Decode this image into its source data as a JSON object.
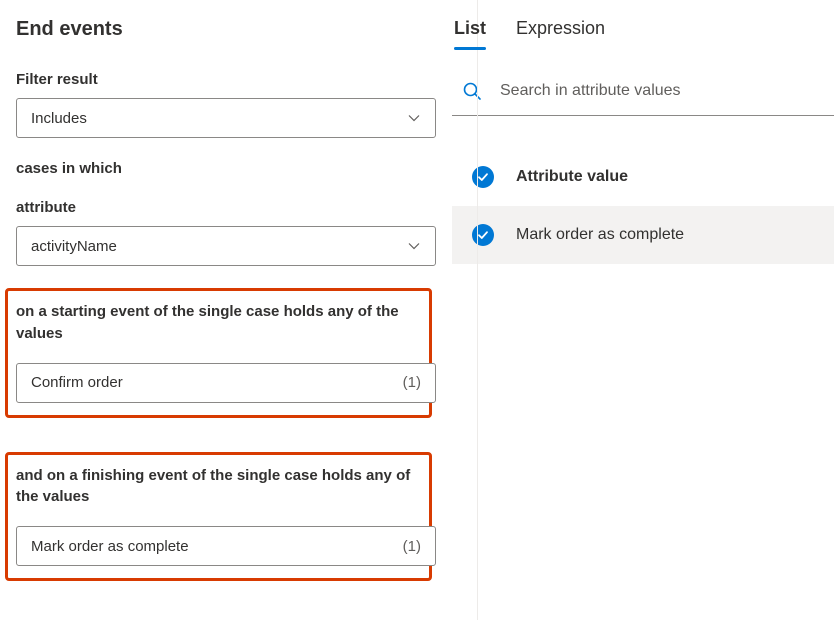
{
  "page_title": "End events",
  "filter_result": {
    "label": "Filter result",
    "value": "Includes"
  },
  "cases_text": "cases in which",
  "attribute": {
    "label": "attribute",
    "value": "activityName"
  },
  "starting_event": {
    "label": "on a starting event of the single case holds any of the values",
    "value": "Confirm order",
    "count": "(1)"
  },
  "finishing_event": {
    "label": "and on a finishing event of the single case holds any of the values",
    "value": "Mark order as complete",
    "count": "(1)"
  },
  "tabs": {
    "list": "List",
    "expression": "Expression"
  },
  "search": {
    "placeholder": "Search in attribute values"
  },
  "attribute_values": {
    "header": "Attribute value",
    "items": [
      {
        "label": "Mark order as complete",
        "checked": true
      }
    ]
  }
}
